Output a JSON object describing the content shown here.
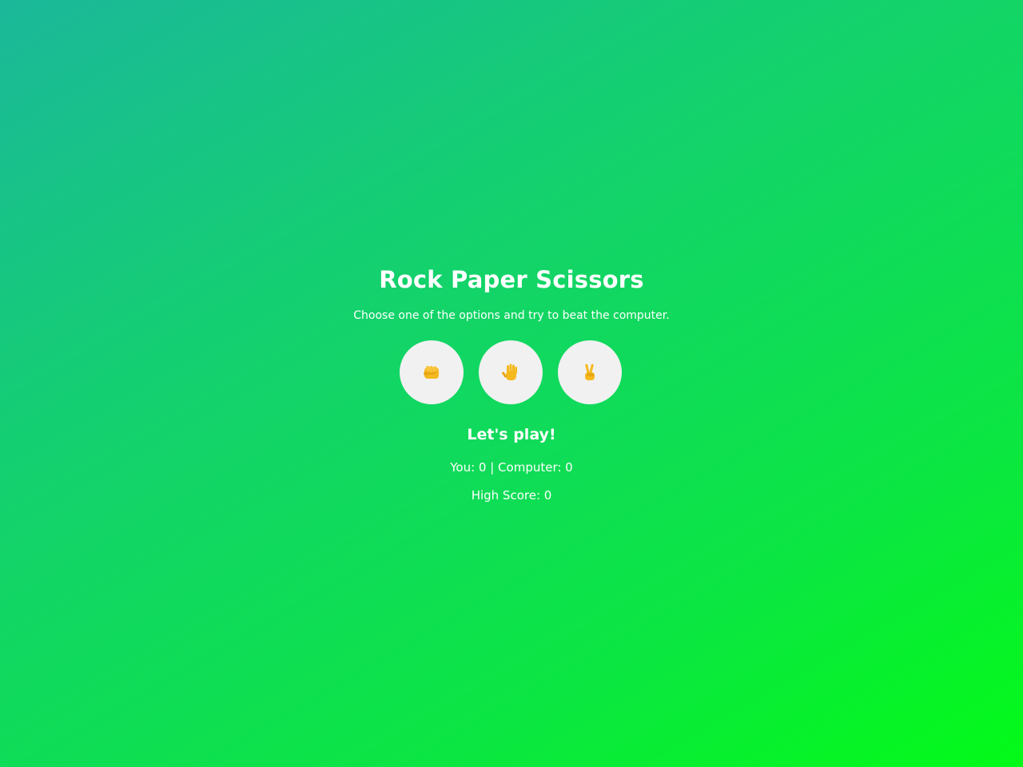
{
  "game": {
    "title": "Rock Paper Scissors",
    "instructions": "Choose one of the options and try to beat the computer.",
    "choices": [
      {
        "id": "rock",
        "icon": "fist-icon"
      },
      {
        "id": "paper",
        "icon": "raised-hand-icon"
      },
      {
        "id": "scissors",
        "icon": "victory-hand-icon"
      }
    ],
    "result_message": "Let's play!",
    "score": {
      "you": 0,
      "computer": 0,
      "text": "You: 0 | Computer: 0"
    },
    "high_score": {
      "value": 0,
      "text": "High Score: 0"
    }
  },
  "colors": {
    "background_start": "#1bb89a",
    "background_end": "#03fb17",
    "button_background": "#f1f1f1",
    "emoji_yellow": "#f5b91e",
    "text": "#ffffff"
  }
}
